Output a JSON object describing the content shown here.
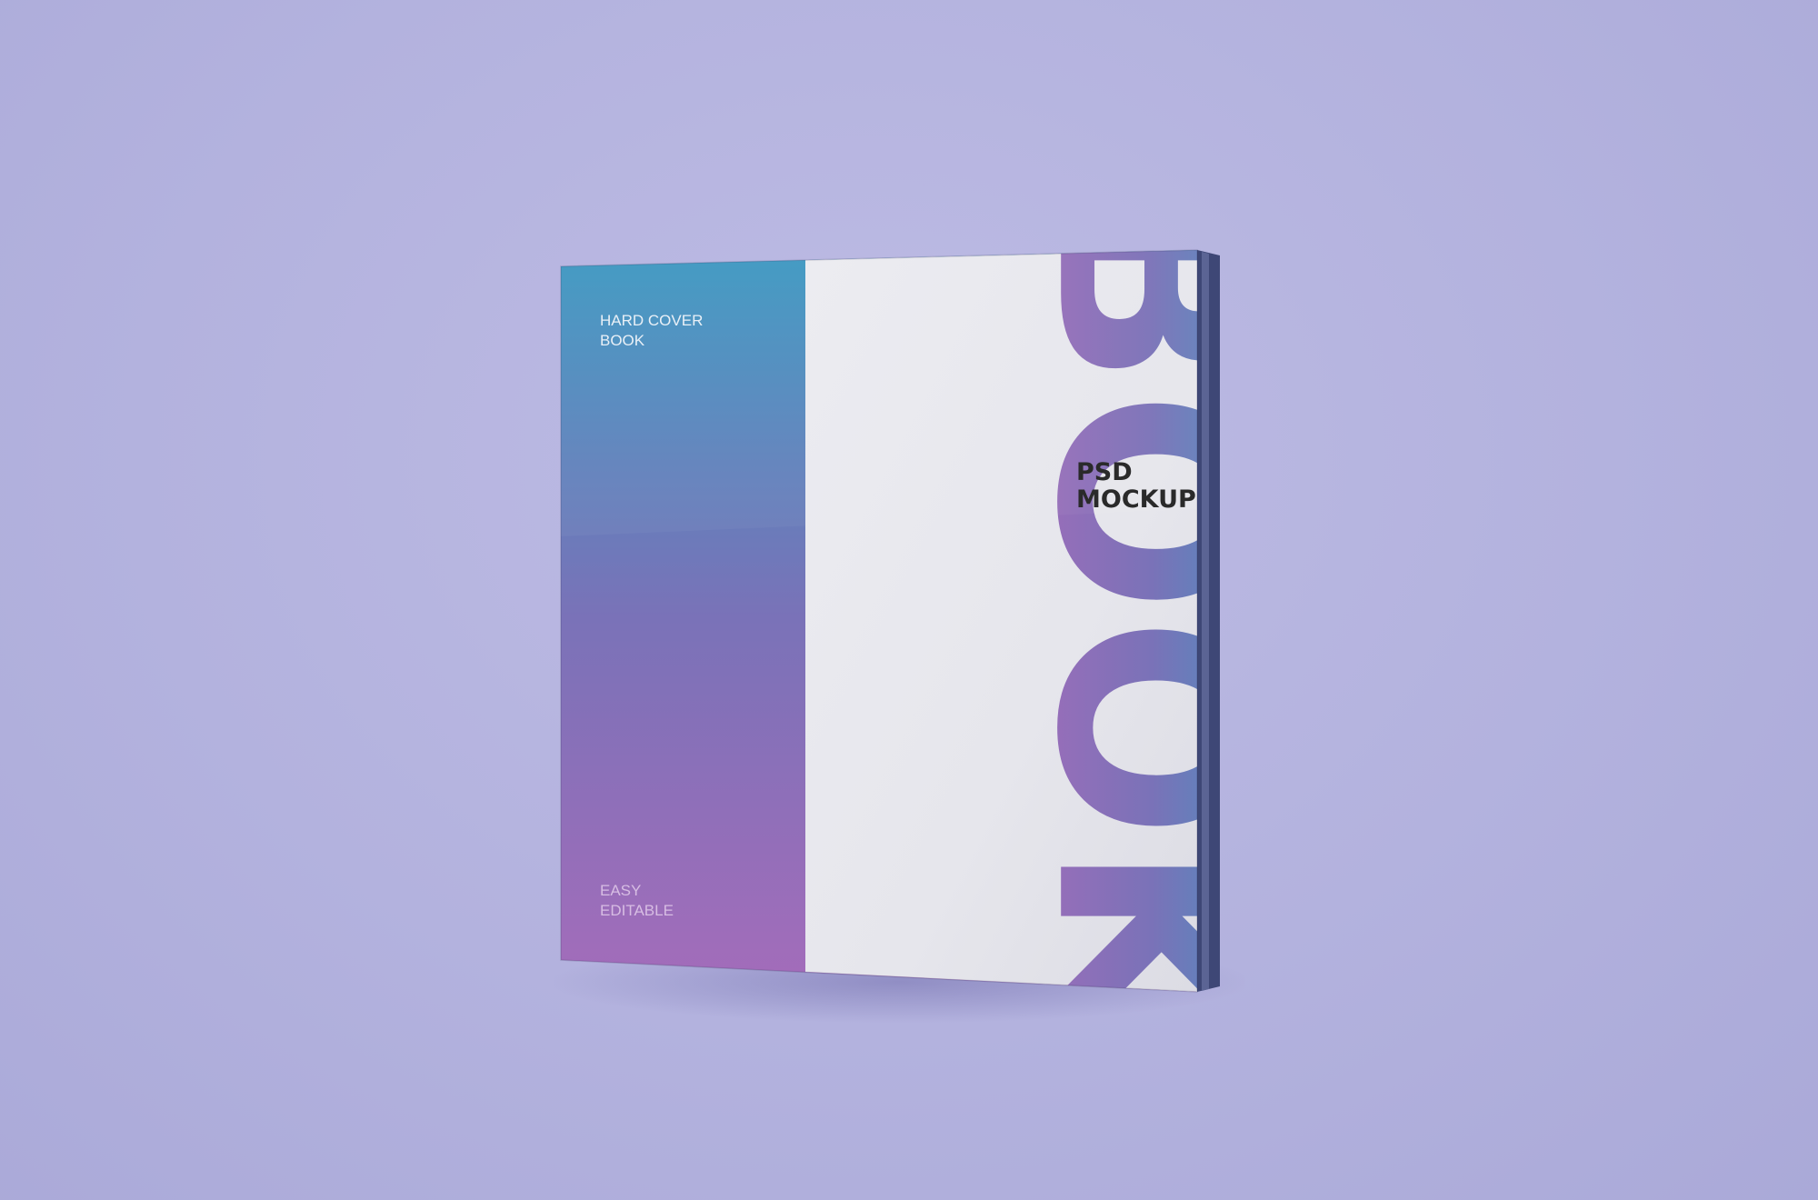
{
  "scene": {
    "background_color": "#b4b3de"
  },
  "book": {
    "cover_label_top": [
      "HARD COVER",
      "BOOK"
    ],
    "cover_label_bottom": [
      "EASY",
      "EDITABLE"
    ],
    "big_word": "BOOK",
    "sub_label": [
      "PSD",
      "MOCKUP"
    ],
    "gradient_colors": [
      "#3a9ac2",
      "#7a72b8",
      "#a56cba"
    ],
    "white_panel_color": "#e9e9ee"
  }
}
